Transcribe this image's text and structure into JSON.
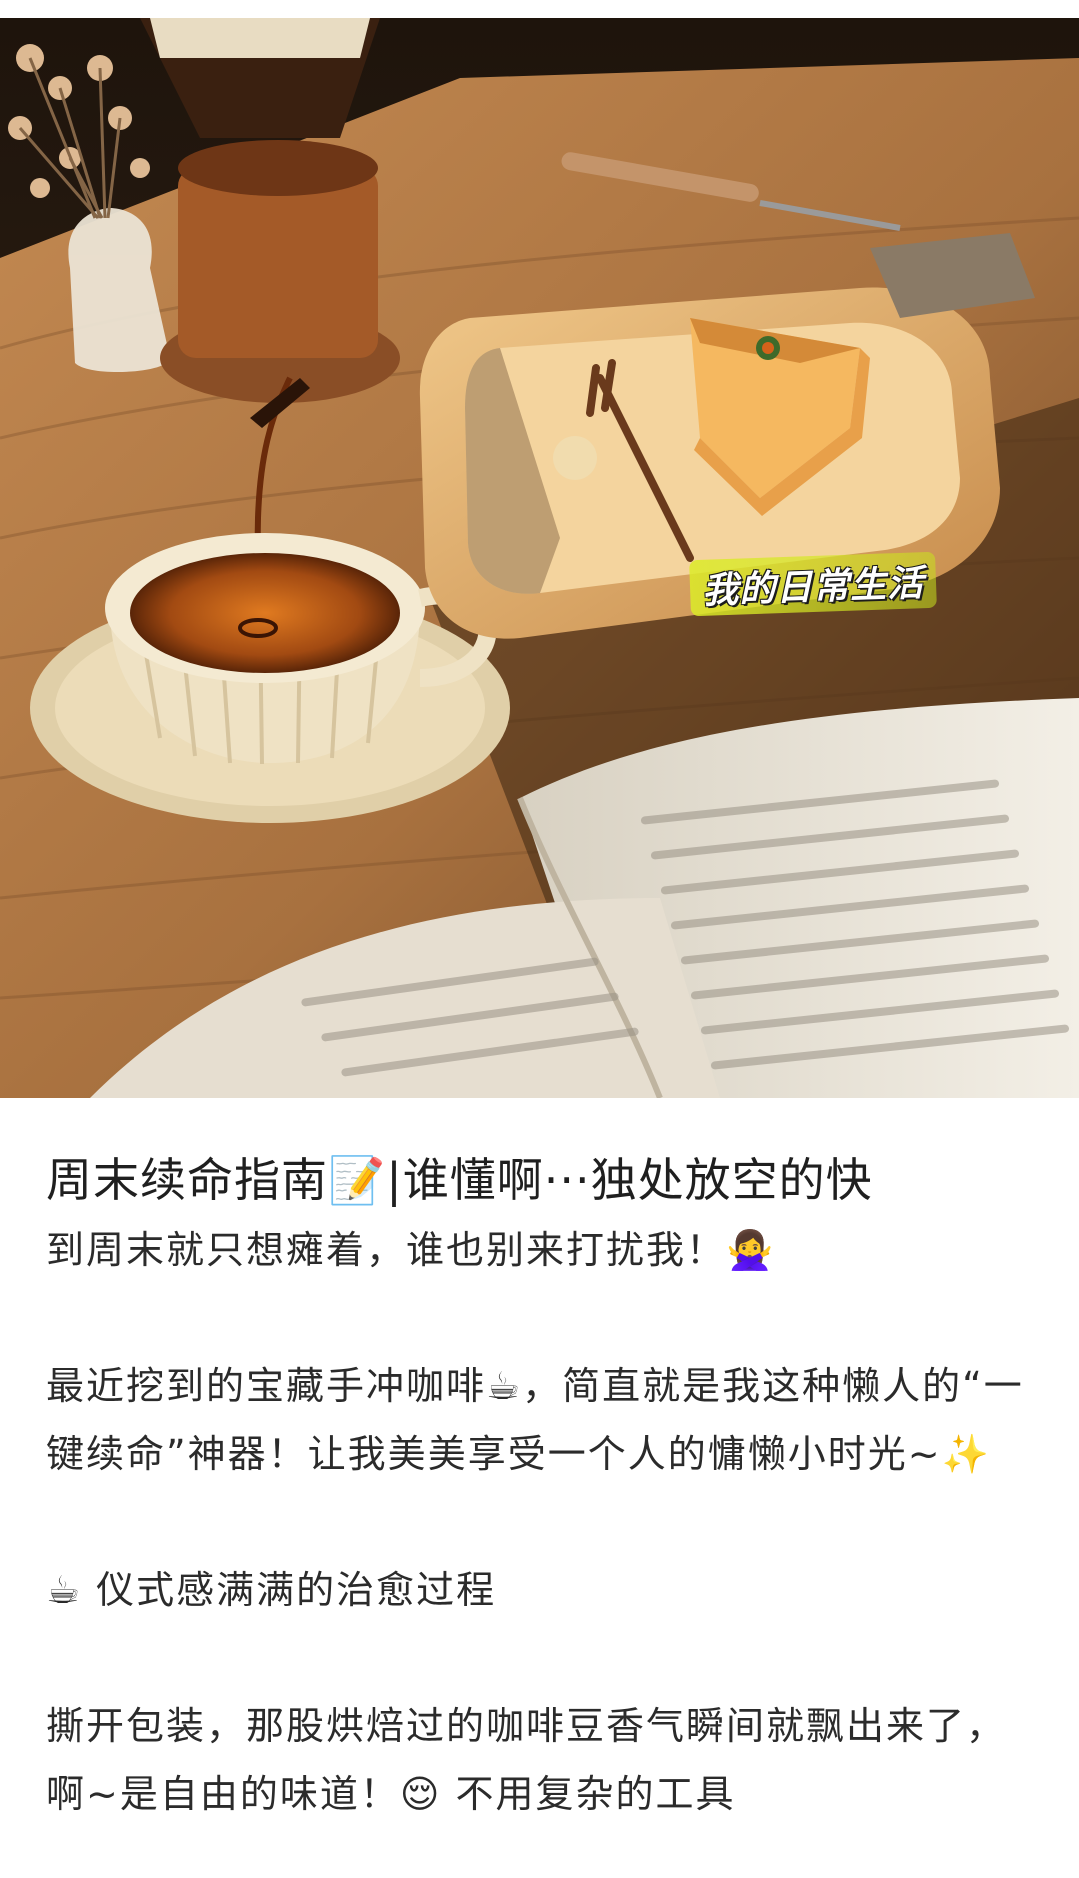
{
  "hero": {
    "caption": "我的日常生活",
    "colors": {
      "wood": "#b07a45",
      "wood_dark": "#5a3a20",
      "cup": "#efe2c4",
      "coffee": "#a9521a",
      "highlight": "#d9e83a"
    }
  },
  "note": {
    "title": "周末续命指南📝|谁懂啊···独处放空的快",
    "paragraphs": [
      "到周末就只想瘫着，谁也别来打扰我！🙅‍♀️",
      "",
      "最近挖到的宝藏手冲咖啡☕，简直就是我这种懒人的“一键续命”神器！让我美美享受一个人的慵懒小时光~✨",
      "",
      "☕ 仪式感满满的治愈过程",
      "",
      "撕开包装，那股烘焙过的咖啡豆香气瞬间就飘出来了，啊~是自由的味道！😌 不用复杂的工具"
    ]
  }
}
